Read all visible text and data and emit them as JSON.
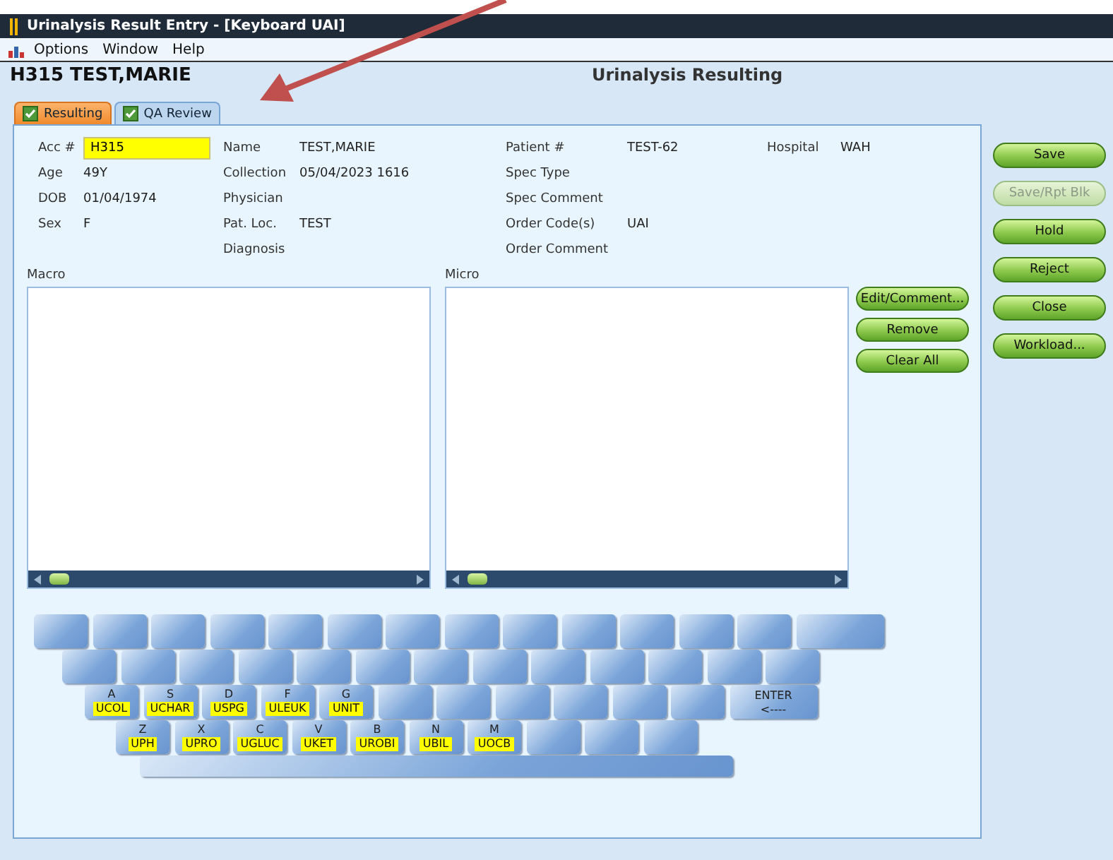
{
  "window": {
    "title": "Urinalysis Result Entry - [Keyboard UAI]"
  },
  "menu": [
    "Options",
    "Window",
    "Help"
  ],
  "header": {
    "patient": "H315 TEST,MARIE",
    "screen": "Urinalysis Resulting"
  },
  "tabs": [
    {
      "label": "Resulting",
      "selected": true,
      "checked": true
    },
    {
      "label": "QA Review",
      "selected": false,
      "checked": true
    }
  ],
  "accession": {
    "label": "Acc #",
    "value": "H315"
  },
  "info_columns": [
    [
      {
        "label": "Age",
        "value": "49Y"
      },
      {
        "label": "DOB",
        "value": "01/04/1974"
      },
      {
        "label": "Sex",
        "value": "F"
      }
    ],
    [
      {
        "label": "Name",
        "value": "TEST,MARIE"
      },
      {
        "label": "Collection",
        "value": "05/04/2023 1616"
      },
      {
        "label": "Physician"
      },
      {
        "label": "Pat. Loc.",
        "value": "TEST"
      },
      {
        "label": "Diagnosis"
      }
    ],
    [
      {
        "label": "Patient #",
        "value": "TEST-62"
      },
      {
        "label": "Spec Type"
      },
      {
        "label": "Spec Comment"
      },
      {
        "label": "Order Code(s)",
        "value": "UAI"
      },
      {
        "label": "Order Comment"
      }
    ],
    [
      {
        "label": "Hospital",
        "value": "WAH"
      }
    ]
  ],
  "lists": [
    {
      "label": "Macro"
    },
    {
      "label": "Micro"
    }
  ],
  "list_buttons": [
    {
      "label": "Edit/Comment..."
    },
    {
      "label": "Remove"
    },
    {
      "label": "Clear All"
    }
  ],
  "side_buttons": [
    {
      "label": "Save",
      "disabled": false
    },
    {
      "label": "Save/Rpt Blk",
      "disabled": true
    },
    {
      "label": "Hold",
      "disabled": false
    },
    {
      "label": "Reject",
      "disabled": false
    },
    {
      "label": "Close",
      "disabled": false
    },
    {
      "label": "Workload...",
      "disabled": false
    }
  ],
  "keyboard": [
    [
      {
        "kind": "blank"
      },
      {
        "kind": "blank"
      },
      {
        "kind": "blank"
      },
      {
        "kind": "blank"
      },
      {
        "kind": "blank"
      },
      {
        "kind": "blank"
      },
      {
        "kind": "blank"
      },
      {
        "kind": "blank"
      },
      {
        "kind": "blank"
      },
      {
        "kind": "blank"
      },
      {
        "kind": "blank"
      },
      {
        "kind": "blank"
      },
      {
        "kind": "blank"
      },
      {
        "kind": "wide"
      }
    ],
    [
      {
        "kind": "blank"
      },
      {
        "kind": "blank"
      },
      {
        "kind": "blank"
      },
      {
        "kind": "blank"
      },
      {
        "kind": "blank"
      },
      {
        "kind": "blank"
      },
      {
        "kind": "blank"
      },
      {
        "kind": "blank"
      },
      {
        "kind": "blank"
      },
      {
        "kind": "blank"
      },
      {
        "kind": "blank"
      },
      {
        "kind": "blank"
      },
      {
        "kind": "blank"
      }
    ],
    [
      {
        "kind": "test",
        "key": "A",
        "code": "UCOL"
      },
      {
        "kind": "test",
        "key": "S",
        "code": "UCHAR"
      },
      {
        "kind": "test",
        "key": "D",
        "code": "USPG"
      },
      {
        "kind": "test",
        "key": "F",
        "code": "ULEUK"
      },
      {
        "kind": "test",
        "key": "G",
        "code": "UNIT"
      },
      {
        "kind": "blank"
      },
      {
        "kind": "blank"
      },
      {
        "kind": "blank"
      },
      {
        "kind": "blank"
      },
      {
        "kind": "blank"
      },
      {
        "kind": "blank"
      },
      {
        "kind": "enter",
        "key": "ENTER",
        "code": "<----"
      }
    ],
    [
      {
        "kind": "test",
        "key": "Z",
        "code": "UPH"
      },
      {
        "kind": "test",
        "key": "X",
        "code": "UPRO"
      },
      {
        "kind": "test",
        "key": "C",
        "code": "UGLUC"
      },
      {
        "kind": "test",
        "key": "V",
        "code": "UKET"
      },
      {
        "kind": "test",
        "key": "B",
        "code": "UROBI"
      },
      {
        "kind": "test",
        "key": "N",
        "code": "UBIL"
      },
      {
        "kind": "test",
        "key": "M",
        "code": "UOCB"
      },
      {
        "kind": "blank"
      },
      {
        "kind": "blank"
      },
      {
        "kind": "blank"
      }
    ],
    [
      {
        "kind": "space"
      }
    ]
  ],
  "annotation": {
    "kind": "arrow"
  }
}
